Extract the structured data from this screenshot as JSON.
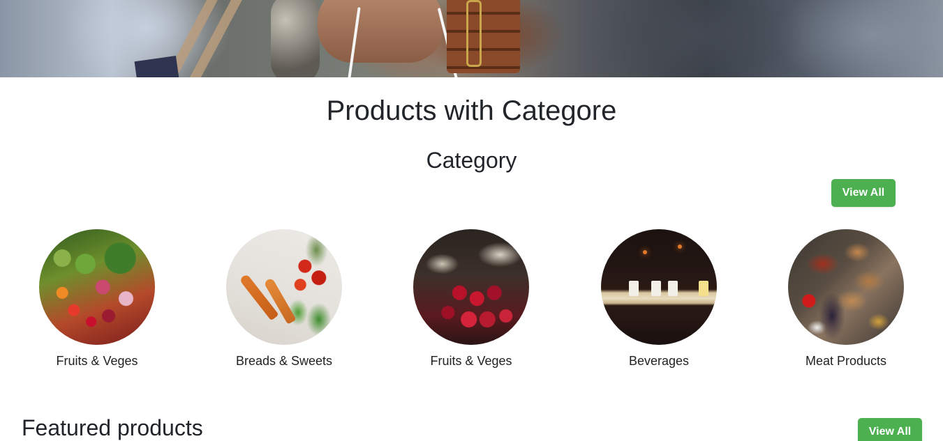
{
  "page": {
    "title": "Products with Categore",
    "category_heading": "Category",
    "category_view_all": "View All",
    "featured_heading": "Featured products",
    "featured_view_all": "View All"
  },
  "categories": [
    {
      "label": "Fruits & Veges",
      "image": "fruits-vegetables-image"
    },
    {
      "label": "Breads & Sweets",
      "image": "carrots-tomatoes-image"
    },
    {
      "label": "Fruits & Veges",
      "image": "berry-tarts-image"
    },
    {
      "label": "Beverages",
      "image": "drinks-bar-image"
    },
    {
      "label": "Meat Products",
      "image": "grilled-meat-image"
    }
  ],
  "colors": {
    "accent_green": "#4caf50",
    "text": "#212529"
  }
}
